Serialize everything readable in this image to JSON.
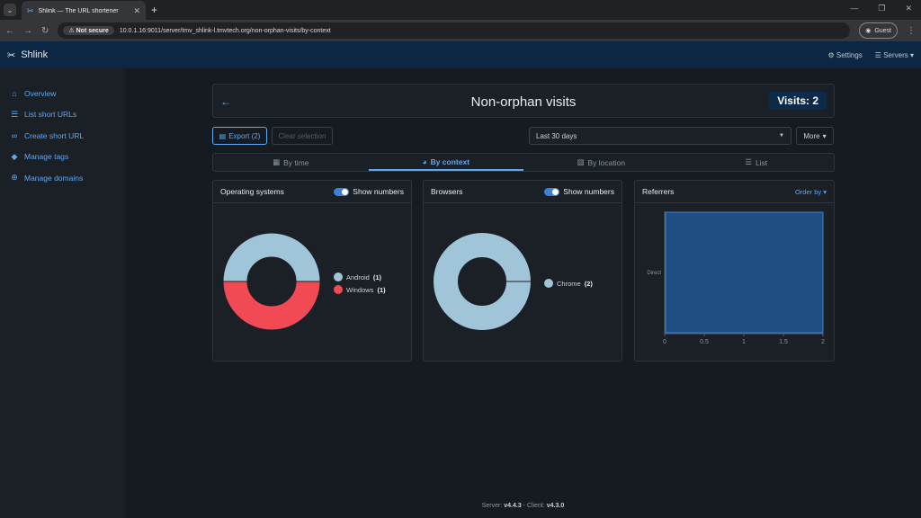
{
  "browser": {
    "tab_title": "Shlink — The URL shortener",
    "not_secure": "Not secure",
    "url": "10.0.1.16:9011/server/tmv_shlink-l.tmvtech.org/non-orphan-visits/by-context",
    "guest": "Guest"
  },
  "nav": {
    "brand": "Shlink",
    "settings": "Settings",
    "servers": "Servers"
  },
  "sidebar": {
    "items": [
      {
        "label": "Overview"
      },
      {
        "label": "List short URLs"
      },
      {
        "label": "Create short URL"
      },
      {
        "label": "Manage tags"
      },
      {
        "label": "Manage domains"
      }
    ]
  },
  "page": {
    "title": "Non-orphan visits",
    "visits": "Visits: 2"
  },
  "actions": {
    "export": "Export (2)",
    "clear": "Clear selection",
    "date_range": "Last 30 days",
    "more": "More"
  },
  "tabs": [
    {
      "label": "By time"
    },
    {
      "label": "By context"
    },
    {
      "label": "By location"
    },
    {
      "label": "List"
    }
  ],
  "os_card": {
    "title": "Operating systems",
    "toggle": "Show numbers"
  },
  "browser_card": {
    "title": "Browsers",
    "toggle": "Show numbers"
  },
  "referrers_card": {
    "title": "Referrers",
    "order": "Order by"
  },
  "footer": {
    "server_label": "Server:",
    "server_version": "v4.4.3",
    "client_label": "Client:",
    "client_version": "v4.3.0"
  },
  "colors": {
    "accent": "#5ea8f0",
    "android": "#a0c4d8",
    "windows": "#f24a54",
    "chrome": "#a0c4d8",
    "bar": "#1f4f82"
  },
  "chart_data": [
    {
      "type": "pie",
      "title": "Operating systems",
      "categories": [
        "Android",
        "Windows"
      ],
      "values": [
        1,
        1
      ],
      "colors": [
        "#a0c4d8",
        "#f24a54"
      ]
    },
    {
      "type": "pie",
      "title": "Browsers",
      "categories": [
        "Chrome"
      ],
      "values": [
        2
      ],
      "colors": [
        "#a0c4d8"
      ]
    },
    {
      "type": "bar",
      "title": "Referrers",
      "orientation": "horizontal",
      "categories": [
        "Direct"
      ],
      "values": [
        2
      ],
      "xlim": [
        0,
        2
      ],
      "xticks": [
        "0",
        "0.5",
        "1",
        "1.5",
        "2"
      ]
    }
  ]
}
